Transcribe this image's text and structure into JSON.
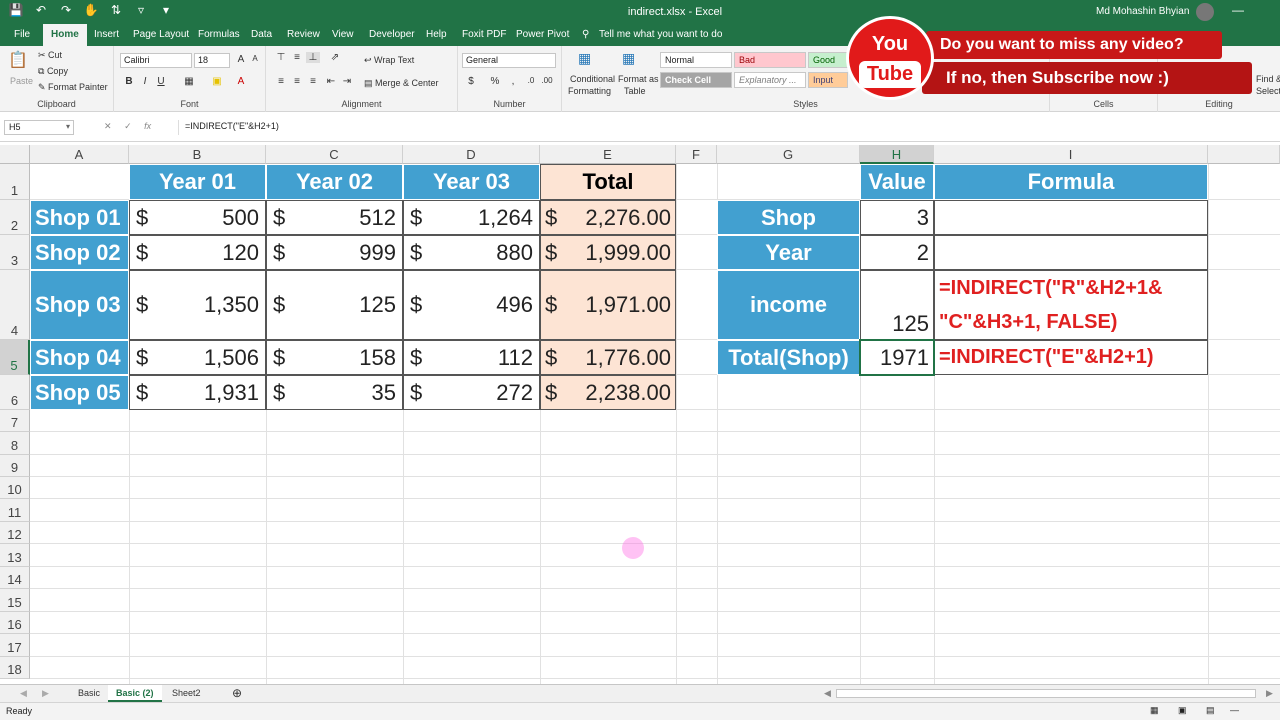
{
  "window": {
    "title": "indirect.xlsx  -  Excel",
    "user": "Md Mohashin Bhyian"
  },
  "ribbon_tabs": [
    "File",
    "Home",
    "Insert",
    "Page Layout",
    "Formulas",
    "Data",
    "Review",
    "View",
    "Developer",
    "Help",
    "Foxit PDF",
    "Power Pivot"
  ],
  "active_tab": "Home",
  "tell_me": "Tell me what you want to do",
  "clipboard": {
    "paste": "Paste",
    "cut": "Cut",
    "copy": "Copy",
    "format_painter": "Format Painter",
    "label": "Clipboard"
  },
  "font": {
    "name": "Calibri",
    "size": "18",
    "label": "Font"
  },
  "alignment": {
    "wrap": "Wrap Text",
    "merge": "Merge & Center",
    "label": "Alignment"
  },
  "number": {
    "format": "General",
    "label": "Number"
  },
  "styles": {
    "conditional": "Conditional",
    "formatting": "Formatting",
    "format_as": "Format as",
    "table": "Table",
    "normal": "Normal",
    "bad": "Bad",
    "good": "Good",
    "check": "Check Cell",
    "explanatory": "Explanatory ...",
    "input": "Input",
    "label": "Styles"
  },
  "cells_label": "Cells",
  "editing": {
    "find": "Find &",
    "select": "Select",
    "label": "Editing"
  },
  "name_box": "H5",
  "formula": "=INDIRECT(\"E\"&H2+1)",
  "columns": [
    "A",
    "B",
    "C",
    "D",
    "E",
    "F",
    "G",
    "H",
    "I"
  ],
  "rows": [
    "1",
    "2",
    "3",
    "4",
    "5",
    "6",
    "7",
    "8",
    "9",
    "10",
    "11",
    "12",
    "13",
    "14",
    "15",
    "16",
    "17",
    "18"
  ],
  "table": {
    "headers": [
      "Year 01",
      "Year 02",
      "Year 03",
      "Total"
    ],
    "currency": "$",
    "rows": [
      {
        "shop": "Shop 01",
        "values": [
          "500",
          "512",
          "1,264"
        ],
        "total": "2,276.00"
      },
      {
        "shop": "Shop 02",
        "values": [
          "120",
          "999",
          "880"
        ],
        "total": "1,999.00"
      },
      {
        "shop": "Shop 03",
        "values": [
          "1,350",
          "125",
          "496"
        ],
        "total": "1,971.00"
      },
      {
        "shop": "Shop 04",
        "values": [
          "1,506",
          "158",
          "112"
        ],
        "total": "1,776.00"
      },
      {
        "shop": "Shop 05",
        "values": [
          "1,931",
          "35",
          "272"
        ],
        "total": "2,238.00"
      }
    ]
  },
  "lookup": {
    "value_header": "Value",
    "formula_header": "Formula",
    "rows": [
      {
        "label": "Shop",
        "value": "3",
        "formula": ""
      },
      {
        "label": "Year",
        "value": "2",
        "formula": ""
      },
      {
        "label": "income",
        "value": "125",
        "formula_line1": "=INDIRECT(\"R\"&H2+1&",
        "formula_line2": "\"C\"&H3+1, FALSE)"
      },
      {
        "label": "Total(Shop)",
        "value": "1971",
        "formula": "=INDIRECT(\"E\"&H2+1)"
      }
    ]
  },
  "sheets": [
    "Basic",
    "Basic (2)",
    "Sheet2"
  ],
  "active_sheet": "Basic (2)",
  "status": "Ready",
  "banner": {
    "logo_top": "You",
    "logo_bottom": "Tube",
    "line1": "Do you want to miss any video?",
    "line2": "If no, then Subscribe now :)"
  },
  "colors": {
    "excel_green": "#217346",
    "header_blue": "#42a0d0",
    "total_fill": "#fde4d4",
    "formula_red": "#e02020"
  }
}
